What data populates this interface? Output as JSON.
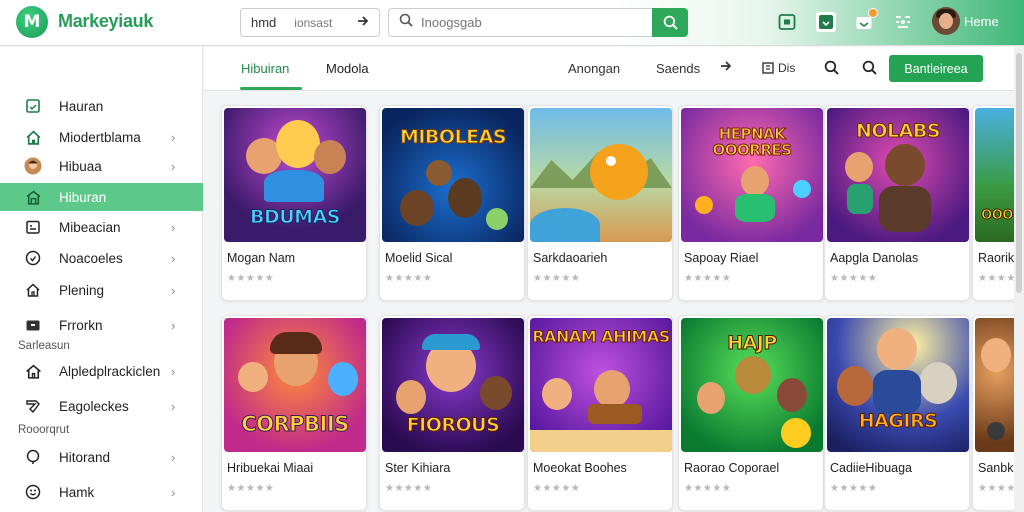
{
  "brand": {
    "logo_letter": "M",
    "name": "Markeyiauk"
  },
  "filter": {
    "primary": "hmd",
    "secondary": "ionsast"
  },
  "search": {
    "placeholder": "Inoogsgab"
  },
  "user": {
    "name": "Heme"
  },
  "colors": {
    "accent": "#2ea85a",
    "active_nav": "#5cc98b",
    "notif": "#f39b2f"
  },
  "sidebar": {
    "items": [
      {
        "label": "Hauran",
        "icon": "box-icon",
        "chevron": false
      },
      {
        "label": "Miodertblama",
        "icon": "home-icon",
        "chevron": true
      },
      {
        "label": "Hibuaa",
        "icon": "avatar-icon",
        "chevron": true
      },
      {
        "label": "Hiburan",
        "icon": "store-icon",
        "chevron": false,
        "active": true
      },
      {
        "label": "Mibeacian",
        "icon": "calendar-icon",
        "chevron": true
      },
      {
        "label": "Noacoeles",
        "icon": "clock-icon",
        "chevron": true
      },
      {
        "label": "Plening",
        "icon": "house-icon",
        "chevron": true
      },
      {
        "label": "Frrorkn",
        "icon": "folder-icon",
        "chevron": true
      },
      {
        "label": "Alpledplrackiclen",
        "icon": "home-icon",
        "chevron": true
      },
      {
        "label": "Eagoleckes",
        "icon": "tag-icon",
        "chevron": true
      },
      {
        "label": "Hitorand",
        "icon": "pin-icon",
        "chevron": true
      },
      {
        "label": "Hamk",
        "icon": "smile-icon",
        "chevron": true
      }
    ],
    "sections": [
      "Sarleasun",
      "Rooorqrut"
    ]
  },
  "toolbar": {
    "tabs": [
      "Hibuiran",
      "Modola"
    ],
    "sort_label": "Anongan",
    "filter_label": "Saends",
    "view_label": "Dis",
    "cta_label": "Bantleireea"
  },
  "cards": [
    {
      "title": "Mogan Nam",
      "art_text": "BDUMAS",
      "theme": "a"
    },
    {
      "title": "Moelid Sical",
      "art_text": "MIBOLEAS",
      "theme": "b"
    },
    {
      "title": "Sarkdaoarieh",
      "art_text": "",
      "theme": "c"
    },
    {
      "title": "Sapoay Riael",
      "art_text": "HEPNAK OOORRES",
      "theme": "d"
    },
    {
      "title": "Aapgla Danolas",
      "art_text": "NOLABS",
      "theme": "e"
    },
    {
      "title": "Raorik",
      "art_text": "OOO",
      "theme": "f"
    },
    {
      "title": "Hribuekai Miaai",
      "art_text": "CORPBIIS",
      "theme": "g"
    },
    {
      "title": "Ster Kihiara",
      "art_text": "FIOROUS",
      "theme": "h"
    },
    {
      "title": "Moeokat Boohes",
      "art_text": "RANAM AHIMAS",
      "theme": "i"
    },
    {
      "title": "Raorao Coporael",
      "art_text": "HAJP",
      "theme": "j"
    },
    {
      "title": "CadiieHibuaga",
      "art_text": "HAGIRS",
      "theme": "k"
    },
    {
      "title": "Sanbk",
      "art_text": "",
      "theme": "l"
    }
  ],
  "stars_text": "★★★★★"
}
